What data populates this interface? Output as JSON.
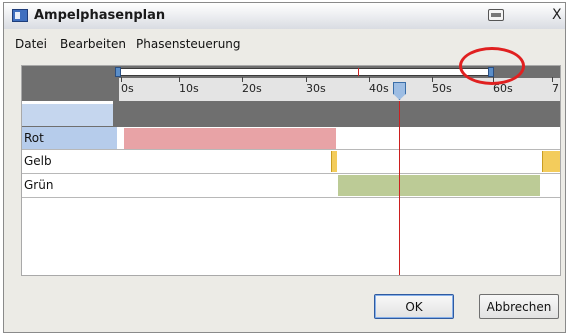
{
  "window": {
    "title": "Ampelphasenplan",
    "close": "X"
  },
  "menu": [
    "Datei",
    "Bearbeiten",
    "Phasensteuerung"
  ],
  "timeline": {
    "ticks": [
      "0s",
      "10s",
      "20s",
      "30s",
      "40s",
      "50s",
      "60s",
      "7"
    ],
    "cursor_seconds": 44
  },
  "lanes": [
    "Rot",
    "Gelb",
    "Grün"
  ],
  "phase_colors": {
    "red": "#e8a3a6",
    "yellow": "#f3cc5c",
    "green": "#bccb96"
  },
  "buttons": {
    "ok": "OK",
    "cancel": "Abbrechen"
  }
}
